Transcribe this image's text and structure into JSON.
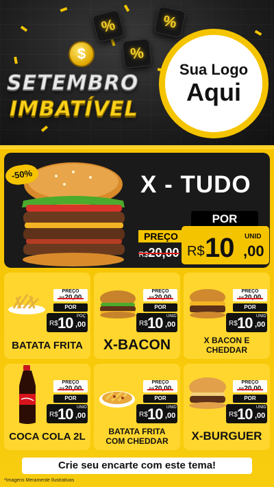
{
  "header": {
    "title_line1": "SETEMBRO",
    "title_line2": "IMBATÍVEL",
    "coin_symbol": "$",
    "percent_symbol": "%",
    "logo_line1": "Sua Logo",
    "logo_line2": "Aqui"
  },
  "hero": {
    "name": "X - TUDO",
    "discount": "-50%",
    "por_label": "POR",
    "preco_label": "PREÇO",
    "old_currency": "R$",
    "old_price": "20,00",
    "currency": "R$",
    "price_int": "10",
    "price_dec": ",00",
    "unit": "UNID"
  },
  "products": [
    {
      "name": "BATATA FRITA",
      "preco_label": "PREÇO",
      "old_currency": "R$",
      "old_price": "20,00",
      "por_label": "POR",
      "currency": "R$",
      "price_int": "10",
      "price_dec": ",00",
      "unit": "POÇ"
    },
    {
      "name": "X-BACON",
      "preco_label": "PREÇO",
      "old_currency": "R$",
      "old_price": "20,00",
      "por_label": "POR",
      "currency": "R$",
      "price_int": "10",
      "price_dec": ",00",
      "unit": "UNID"
    },
    {
      "name": "X BACON E CHEDDAR",
      "preco_label": "PREÇO",
      "old_currency": "R$",
      "old_price": "20,00",
      "por_label": "POR",
      "currency": "R$",
      "price_int": "10",
      "price_dec": ",00",
      "unit": "UNID"
    },
    {
      "name": "COCA COLA 2L",
      "preco_label": "PREÇO",
      "old_currency": "R$",
      "old_price": "20,00",
      "por_label": "POR",
      "currency": "R$",
      "price_int": "10",
      "price_dec": ",00",
      "unit": "UNID"
    },
    {
      "name": "BATATA FRITA COM CHEDDAR",
      "preco_label": "PREÇO",
      "old_currency": "R$",
      "old_price": "20,00",
      "por_label": "POR",
      "currency": "R$",
      "price_int": "10",
      "price_dec": ",00",
      "unit": "UNID"
    },
    {
      "name": "X-BURGUER",
      "preco_label": "PREÇO",
      "old_currency": "R$",
      "old_price": "20,00",
      "por_label": "POR",
      "currency": "R$",
      "price_int": "10",
      "price_dec": ",00",
      "unit": "UNID"
    }
  ],
  "footer": {
    "cta": "Crie seu encarte com este tema!",
    "disclaimer": "*Imagens Meramente Ilustrativas"
  },
  "colors": {
    "accent_yellow": "#f5c400",
    "dark": "#1a1a1a",
    "strike_red": "#e31b1b"
  }
}
